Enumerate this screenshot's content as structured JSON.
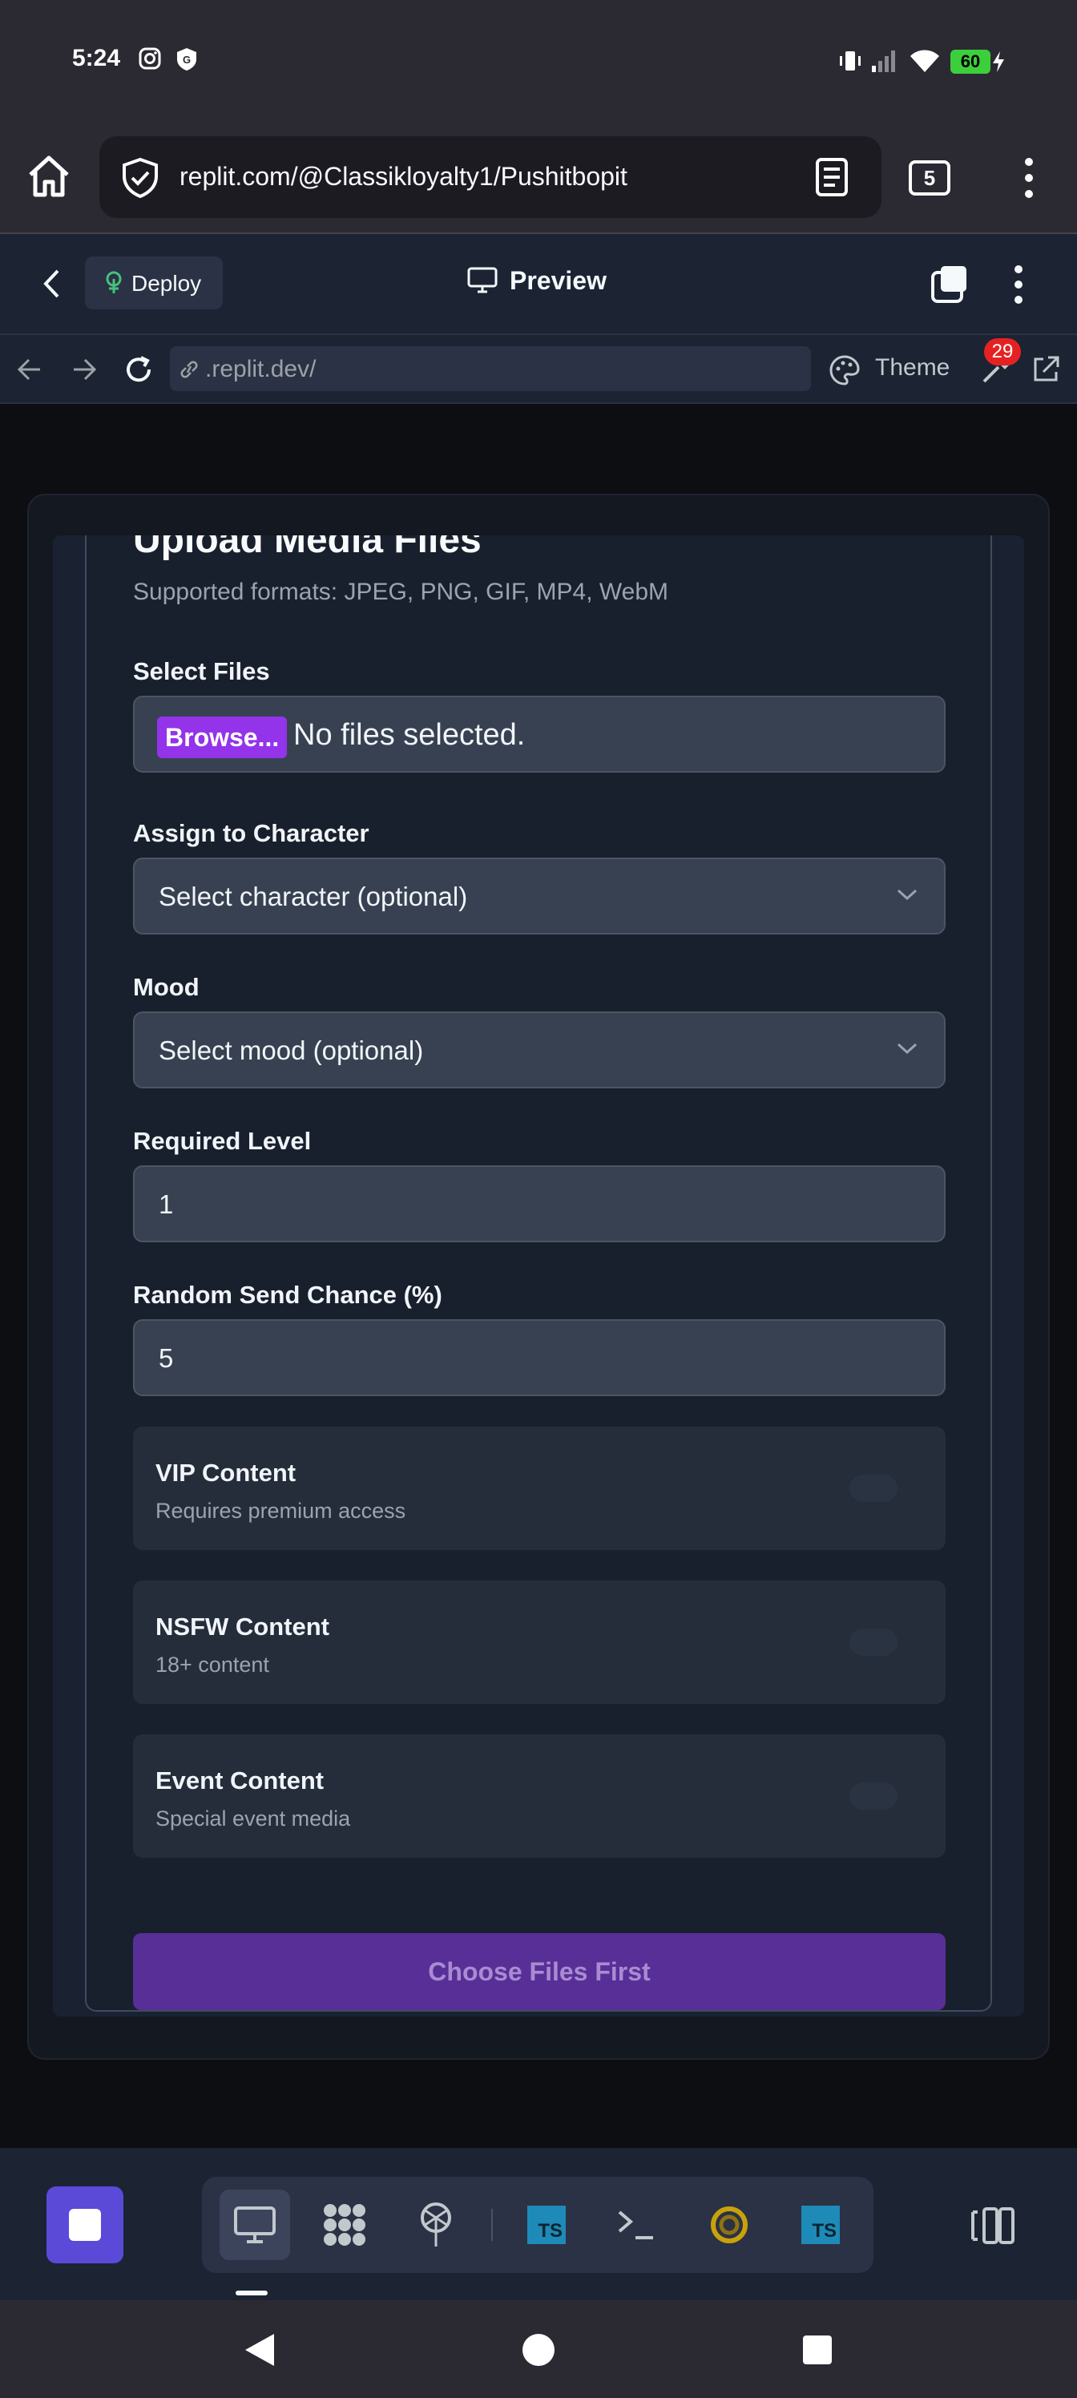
{
  "status_bar": {
    "time": "5:24",
    "battery": "60"
  },
  "browser": {
    "url": "replit.com/@Classikloyalty1/Pushitbopit",
    "tab_count": "5"
  },
  "replit": {
    "deploy_label": "Deploy",
    "preview_title": "Preview",
    "webview_url": ".replit.dev/",
    "theme_label": "Theme",
    "devtools_badge": "29"
  },
  "form": {
    "title": "Upload Media Files",
    "subtitle": "Supported formats: JPEG, PNG, GIF, MP4, WebM",
    "select_files_label": "Select Files",
    "browse_label": "Browse...",
    "no_files_text": "No files selected.",
    "character_label": "Assign to Character",
    "character_value": "Select character (optional)",
    "mood_label": "Mood",
    "mood_value": "Select mood (optional)",
    "level_label": "Required Level",
    "level_value": "1",
    "chance_label": "Random Send Chance (%)",
    "chance_value": "5",
    "toggles": [
      {
        "title": "VIP Content",
        "desc": "Requires premium access"
      },
      {
        "title": "NSFW Content",
        "desc": "18+ content"
      },
      {
        "title": "Event Content",
        "desc": "Special event media"
      }
    ],
    "submit_label": "Choose Files First"
  },
  "colors": {
    "accent_purple": "#9333ea",
    "submit_disabled": "#582f96",
    "stop_button": "#5b4ad8",
    "battery_green": "#3ccf3c",
    "badge_red": "#e52222"
  }
}
